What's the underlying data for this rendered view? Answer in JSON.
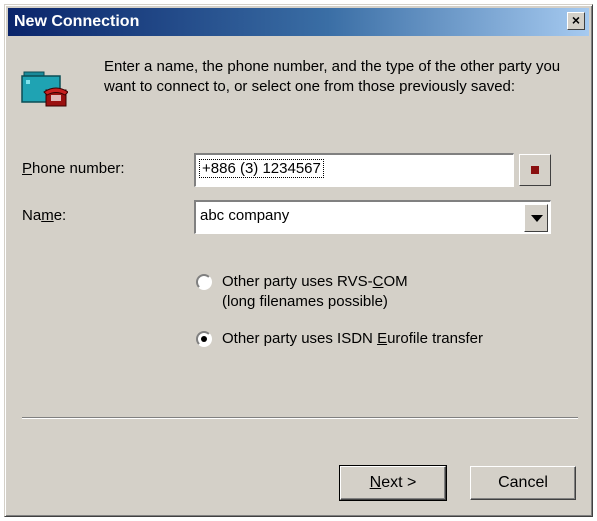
{
  "window": {
    "title": "New Connection",
    "close_glyph": "×"
  },
  "intro_text": "Enter a name, the phone number, and the type of the other party you want to connect to, or select one from those previously saved:",
  "phone": {
    "label_prefix": "P",
    "label_rest": "hone number:",
    "value": "+886 (3) 1234567"
  },
  "name": {
    "label_prefix": "Na",
    "label_mid": "m",
    "label_rest": "e:",
    "value": "abc company"
  },
  "options": [
    {
      "line1_a": "Other party uses RVS-",
      "line1_u": "C",
      "line1_b": "OM",
      "line2": "(long filenames possible)",
      "selected": false
    },
    {
      "line1_a": "Other party uses ISDN ",
      "line1_u": "E",
      "line1_b": "urofile transfer",
      "selected": true
    }
  ],
  "buttons": {
    "next_u": "N",
    "next_rest": "ext >",
    "cancel": "Cancel"
  },
  "icons": {
    "app": "folder-phone-icon",
    "dial": "dial-icon",
    "dropdown": "chevron-down-icon",
    "close": "close-icon"
  },
  "colors": {
    "title_start": "#0a246a",
    "title_end": "#a6caf0",
    "face": "#d4d0c8",
    "dial_square": "#8a1010"
  }
}
